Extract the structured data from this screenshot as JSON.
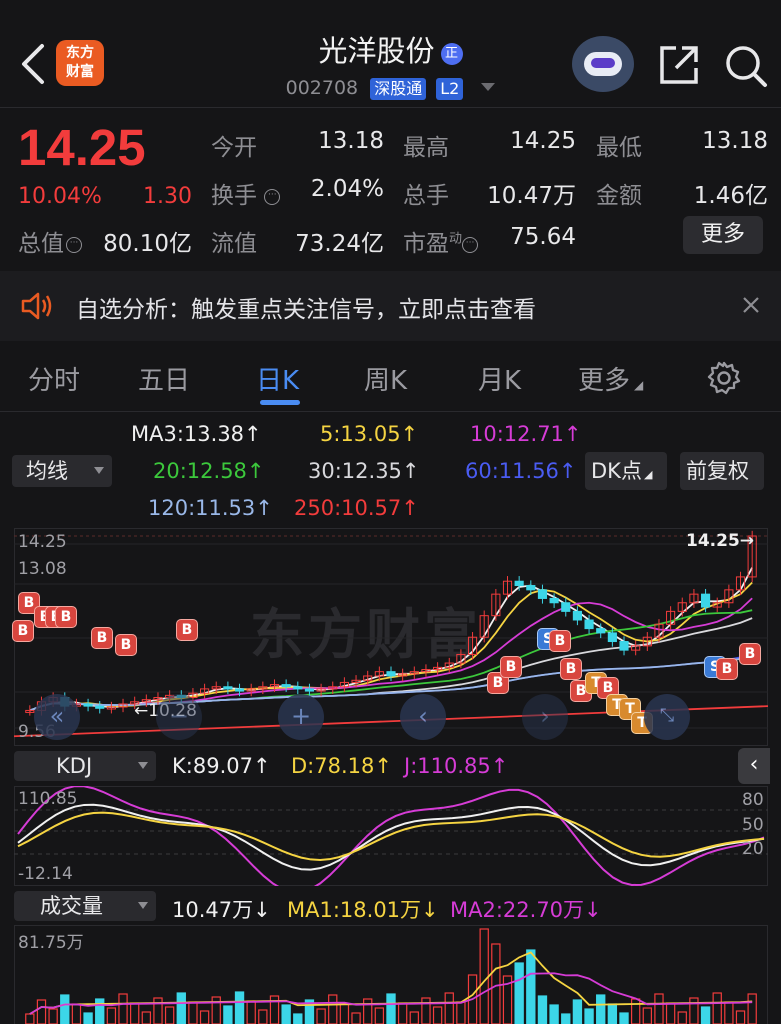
{
  "header": {
    "back_icon": "chevron-left-icon",
    "logo_line1": "东方",
    "logo_line2": "财富",
    "title": "光洋股份",
    "title_badge": "正",
    "code": "002708",
    "tag_connect": "深股通",
    "tag_level": "L2"
  },
  "quote": {
    "price": "14.25",
    "change_pct": "10.04%",
    "change_amt": "1.30",
    "open_label": "今开",
    "open_value": "13.18",
    "high_label": "最高",
    "high_value": "14.25",
    "low_label": "最低",
    "low_value": "13.18",
    "turnover_label": "换手",
    "turnover_value": "2.04%",
    "volume_label": "总手",
    "volume_value": "10.47万",
    "amount_label": "金额",
    "amount_value": "1.46亿",
    "mktcap_label": "总值",
    "mktcap_value": "80.10亿",
    "float_label": "流值",
    "float_value": "73.24亿",
    "pe_label": "市盈",
    "pe_sup": "动",
    "pe_value": "75.64",
    "more_label": "更多"
  },
  "banner": {
    "icon": "speaker-icon",
    "text": "自选分析：触发重点关注信号，立即点击查看",
    "close_icon": "close-icon"
  },
  "tabs": [
    "分时",
    "五日",
    "日K",
    "周K",
    "月K",
    "更多"
  ],
  "ma_legend": {
    "selector": "均线",
    "items": [
      {
        "text": "MA3:13.38↑",
        "color": "#f0f0f0"
      },
      {
        "text": "5:13.05↑",
        "color": "#f5d442"
      },
      {
        "text": "10:12.71↑",
        "color": "#d63cd6"
      },
      {
        "text": "20:12.58↑",
        "color": "#3cc83c"
      },
      {
        "text": "30:12.35↑",
        "color": "#d8d8dc"
      },
      {
        "text": "60:11.56↑",
        "color": "#4a5cf2"
      },
      {
        "text": "120:11.53↑",
        "color": "#9ab8e8"
      },
      {
        "text": "250:10.57↑",
        "color": "#f23c3c"
      }
    ],
    "dk_button": "DK点",
    "fq_button": "前复权"
  },
  "kline": {
    "y_top": "14.25",
    "y_mid": "13.08",
    "y_low": "9.56",
    "last_price_label": "14.25→",
    "min_label": "←10.28",
    "watermark": "东方财富",
    "ylim": [
      9.56,
      14.25
    ]
  },
  "kdj": {
    "selector": "KDJ",
    "k": "K:89.07↑",
    "d": "D:78.18↑",
    "j": "J:110.85↑",
    "y_top": "110.85",
    "y_bottom": "-12.14",
    "lvl80": "80",
    "lvl50": "50",
    "lvl20": "20"
  },
  "volume": {
    "selector": "成交量",
    "current": "10.47万↓",
    "ma1": "MA1:18.01万↓",
    "ma2": "MA2:22.70万↓",
    "y_top": "81.75万"
  },
  "chart_data": {
    "type": "candlestick",
    "ylim": [
      9.56,
      14.25
    ],
    "close": [
      10.2,
      10.4,
      10.5,
      10.3,
      10.35,
      10.3,
      10.25,
      10.28,
      10.35,
      10.4,
      10.45,
      10.5,
      10.55,
      10.5,
      10.6,
      10.7,
      10.75,
      10.7,
      10.65,
      10.7,
      10.75,
      10.8,
      10.75,
      10.7,
      10.65,
      10.7,
      10.75,
      10.85,
      10.9,
      11.0,
      11.1,
      11.0,
      11.05,
      11.1,
      11.15,
      11.2,
      11.3,
      11.5,
      11.9,
      12.4,
      12.9,
      13.2,
      13.1,
      13.0,
      12.8,
      12.7,
      12.5,
      12.3,
      12.1,
      12.0,
      11.8,
      11.6,
      11.7,
      11.9,
      12.2,
      12.5,
      12.7,
      12.9,
      12.6,
      12.7,
      13.0,
      13.3,
      14.25
    ]
  }
}
